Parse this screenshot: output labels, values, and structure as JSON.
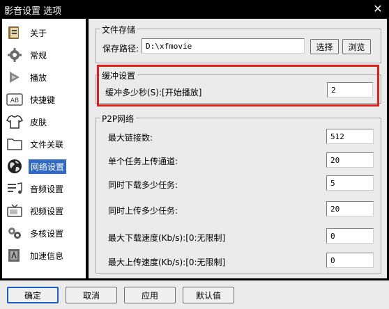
{
  "window": {
    "title": "影音设置 选项"
  },
  "sidebar": {
    "items": [
      {
        "label": "关于",
        "icon": "about-icon"
      },
      {
        "label": "常规",
        "icon": "gear-icon"
      },
      {
        "label": "播放",
        "icon": "play-icon"
      },
      {
        "label": "快捷键",
        "icon": "keyboard-icon"
      },
      {
        "label": "皮肤",
        "icon": "shirt-icon"
      },
      {
        "label": "文件关联",
        "icon": "folder-icon"
      },
      {
        "label": "网络设置",
        "icon": "globe-icon",
        "active": true
      },
      {
        "label": "音频设置",
        "icon": "audio-icon"
      },
      {
        "label": "视频设置",
        "icon": "tv-icon"
      },
      {
        "label": "多核设置",
        "icon": "multicore-icon"
      },
      {
        "label": "加速信息",
        "icon": "acceleration-icon"
      }
    ]
  },
  "storage": {
    "title": "文件存储",
    "path_label": "保存路径:",
    "path_value": "D:\\xfmovie",
    "select_label": "选择",
    "browse_label": "浏览"
  },
  "buffer": {
    "title": "缓冲设置",
    "label": "缓冲多少秒(S):[开始播放]",
    "value": "2"
  },
  "p2p": {
    "title": "P2P网络",
    "rows": [
      {
        "label": "最大链接数:",
        "value": "512"
      },
      {
        "label": "单个任务上传通道:",
        "value": "20"
      },
      {
        "label": "同时下载多少任务:",
        "value": "5"
      },
      {
        "label": "同时上传多少任务:",
        "value": "20"
      },
      {
        "label": "最大下载速度(Kb/s):[0:无限制]",
        "value": "0"
      },
      {
        "label": "最大上传速度(Kb/s):[0:无限制]",
        "value": "0"
      }
    ]
  },
  "footer": {
    "ok": "确定",
    "cancel": "取消",
    "apply": "应用",
    "default": "默认值"
  },
  "colors": {
    "highlight": "#e0201c",
    "selection": "#316ac5"
  }
}
